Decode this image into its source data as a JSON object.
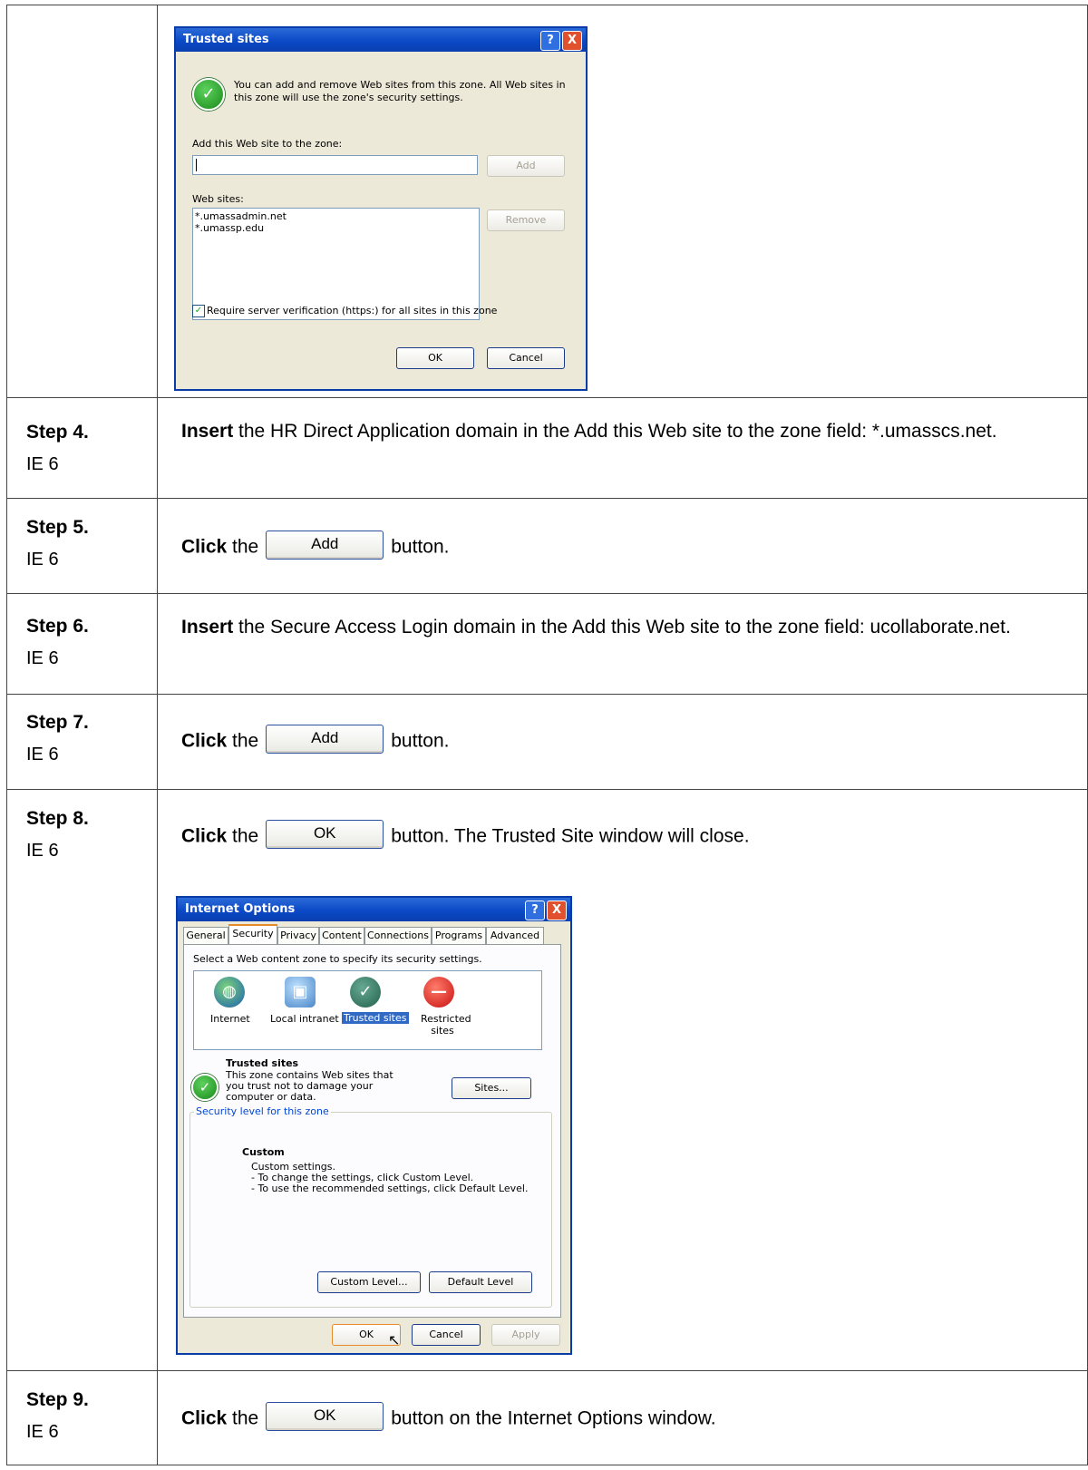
{
  "trusted_dialog": {
    "title": "Trusted sites",
    "help_btn": "?",
    "close_btn": "X",
    "description": "You can add and remove Web sites from this zone. All Web sites in this zone will use the zone's security settings.",
    "add_label": "Add this Web site to the zone:",
    "add_input_value": "",
    "add_button": "Add",
    "websites_label": "Web sites:",
    "websites": [
      "*.umassadmin.net",
      "*.umassp.edu"
    ],
    "remove_button": "Remove",
    "require_https": "Require server verification (https:) for all sites in this zone",
    "ok": "OK",
    "cancel": "Cancel"
  },
  "steps": [
    {
      "step": "Step 4.",
      "browser": "IE 6",
      "bold": "Insert",
      "text": " the HR Direct Application domain in the Add this Web site to the zone field: *.umasscs.net."
    },
    {
      "step": "Step 5.",
      "browser": "IE 6",
      "bold": "Click",
      "pre": " the",
      "button": "Add",
      "post": "button."
    },
    {
      "step": "Step 6.",
      "browser": "IE 6",
      "bold": "Insert",
      "text": " the Secure Access Login domain in the Add this Web site to the zone field: ucollaborate.net."
    },
    {
      "step": "Step 7.",
      "browser": "IE 6",
      "bold": "Click",
      "pre": " the",
      "button": "Add",
      "post": "button."
    },
    {
      "step": "Step 8.",
      "browser": "IE 6",
      "bold": "Click",
      "pre": " the",
      "button": "OK",
      "post": "button.  The Trusted Site window will close."
    },
    {
      "step": "Step 9.",
      "browser": "IE 6",
      "bold": "Click",
      "pre": " the",
      "button": "OK",
      "post": "button on the Internet Options window."
    }
  ],
  "internet_options": {
    "title": "Internet Options",
    "tabs": [
      "General",
      "Security",
      "Privacy",
      "Content",
      "Connections",
      "Programs",
      "Advanced"
    ],
    "select_zone_text": "Select a Web content zone to specify its security settings.",
    "zones": [
      "Internet",
      "Local intranet",
      "Trusted sites",
      "Restricted sites"
    ],
    "zone_heading": "Trusted sites",
    "zone_desc": "This zone contains Web sites that you trust not to damage your computer or data.",
    "sites_button": "Sites...",
    "security_level_legend": "Security level for this zone",
    "level_name": "Custom",
    "level_lines": [
      "Custom settings.",
      "- To change the settings, click Custom Level.",
      "- To use the recommended settings, click Default Level."
    ],
    "custom_level_button": "Custom Level...",
    "default_level_button": "Default Level",
    "ok": "OK",
    "cancel": "Cancel",
    "apply": "Apply"
  }
}
